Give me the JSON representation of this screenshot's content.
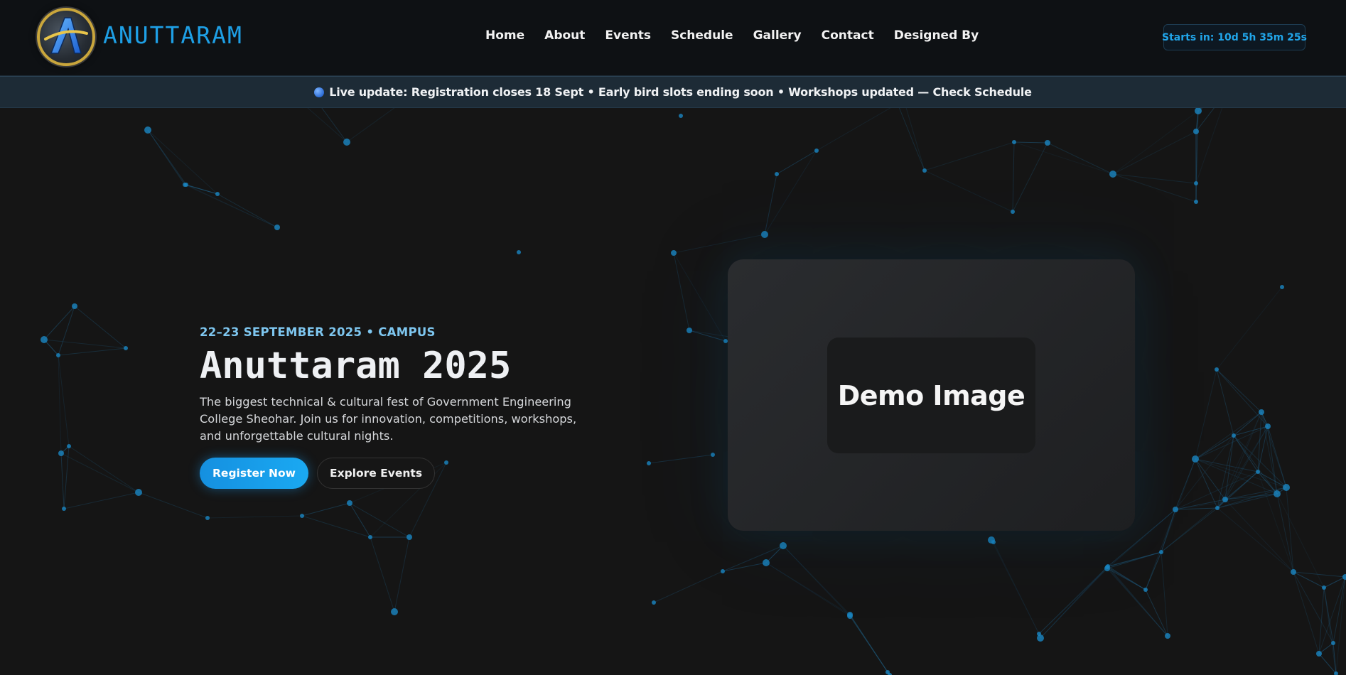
{
  "header": {
    "brand": "ANUTTARAM",
    "nav": [
      "Home",
      "About",
      "Events",
      "Schedule",
      "Gallery",
      "Contact",
      "Designed By"
    ],
    "countdown": "Starts in: 10d 5h 35m 25s"
  },
  "ticker": {
    "text": "Live update: Registration closes 18 Sept • Early bird slots ending soon • Workshops updated — Check Schedule"
  },
  "hero": {
    "date": "22–23 SEPTEMBER 2025 • CAMPUS",
    "title": "Anuttaram 2025",
    "description": "The biggest technical & cultural fest of Government Engineering College Sheohar. Join us for innovation, competitions, workshops, and unforgettable cultural nights.",
    "register_label": "Register Now",
    "explore_label": "Explore Events",
    "image_label": "Demo Image"
  },
  "colors": {
    "accent": "#1ea0e6",
    "background": "#151515",
    "ticker_bg": "#1d2b36"
  }
}
